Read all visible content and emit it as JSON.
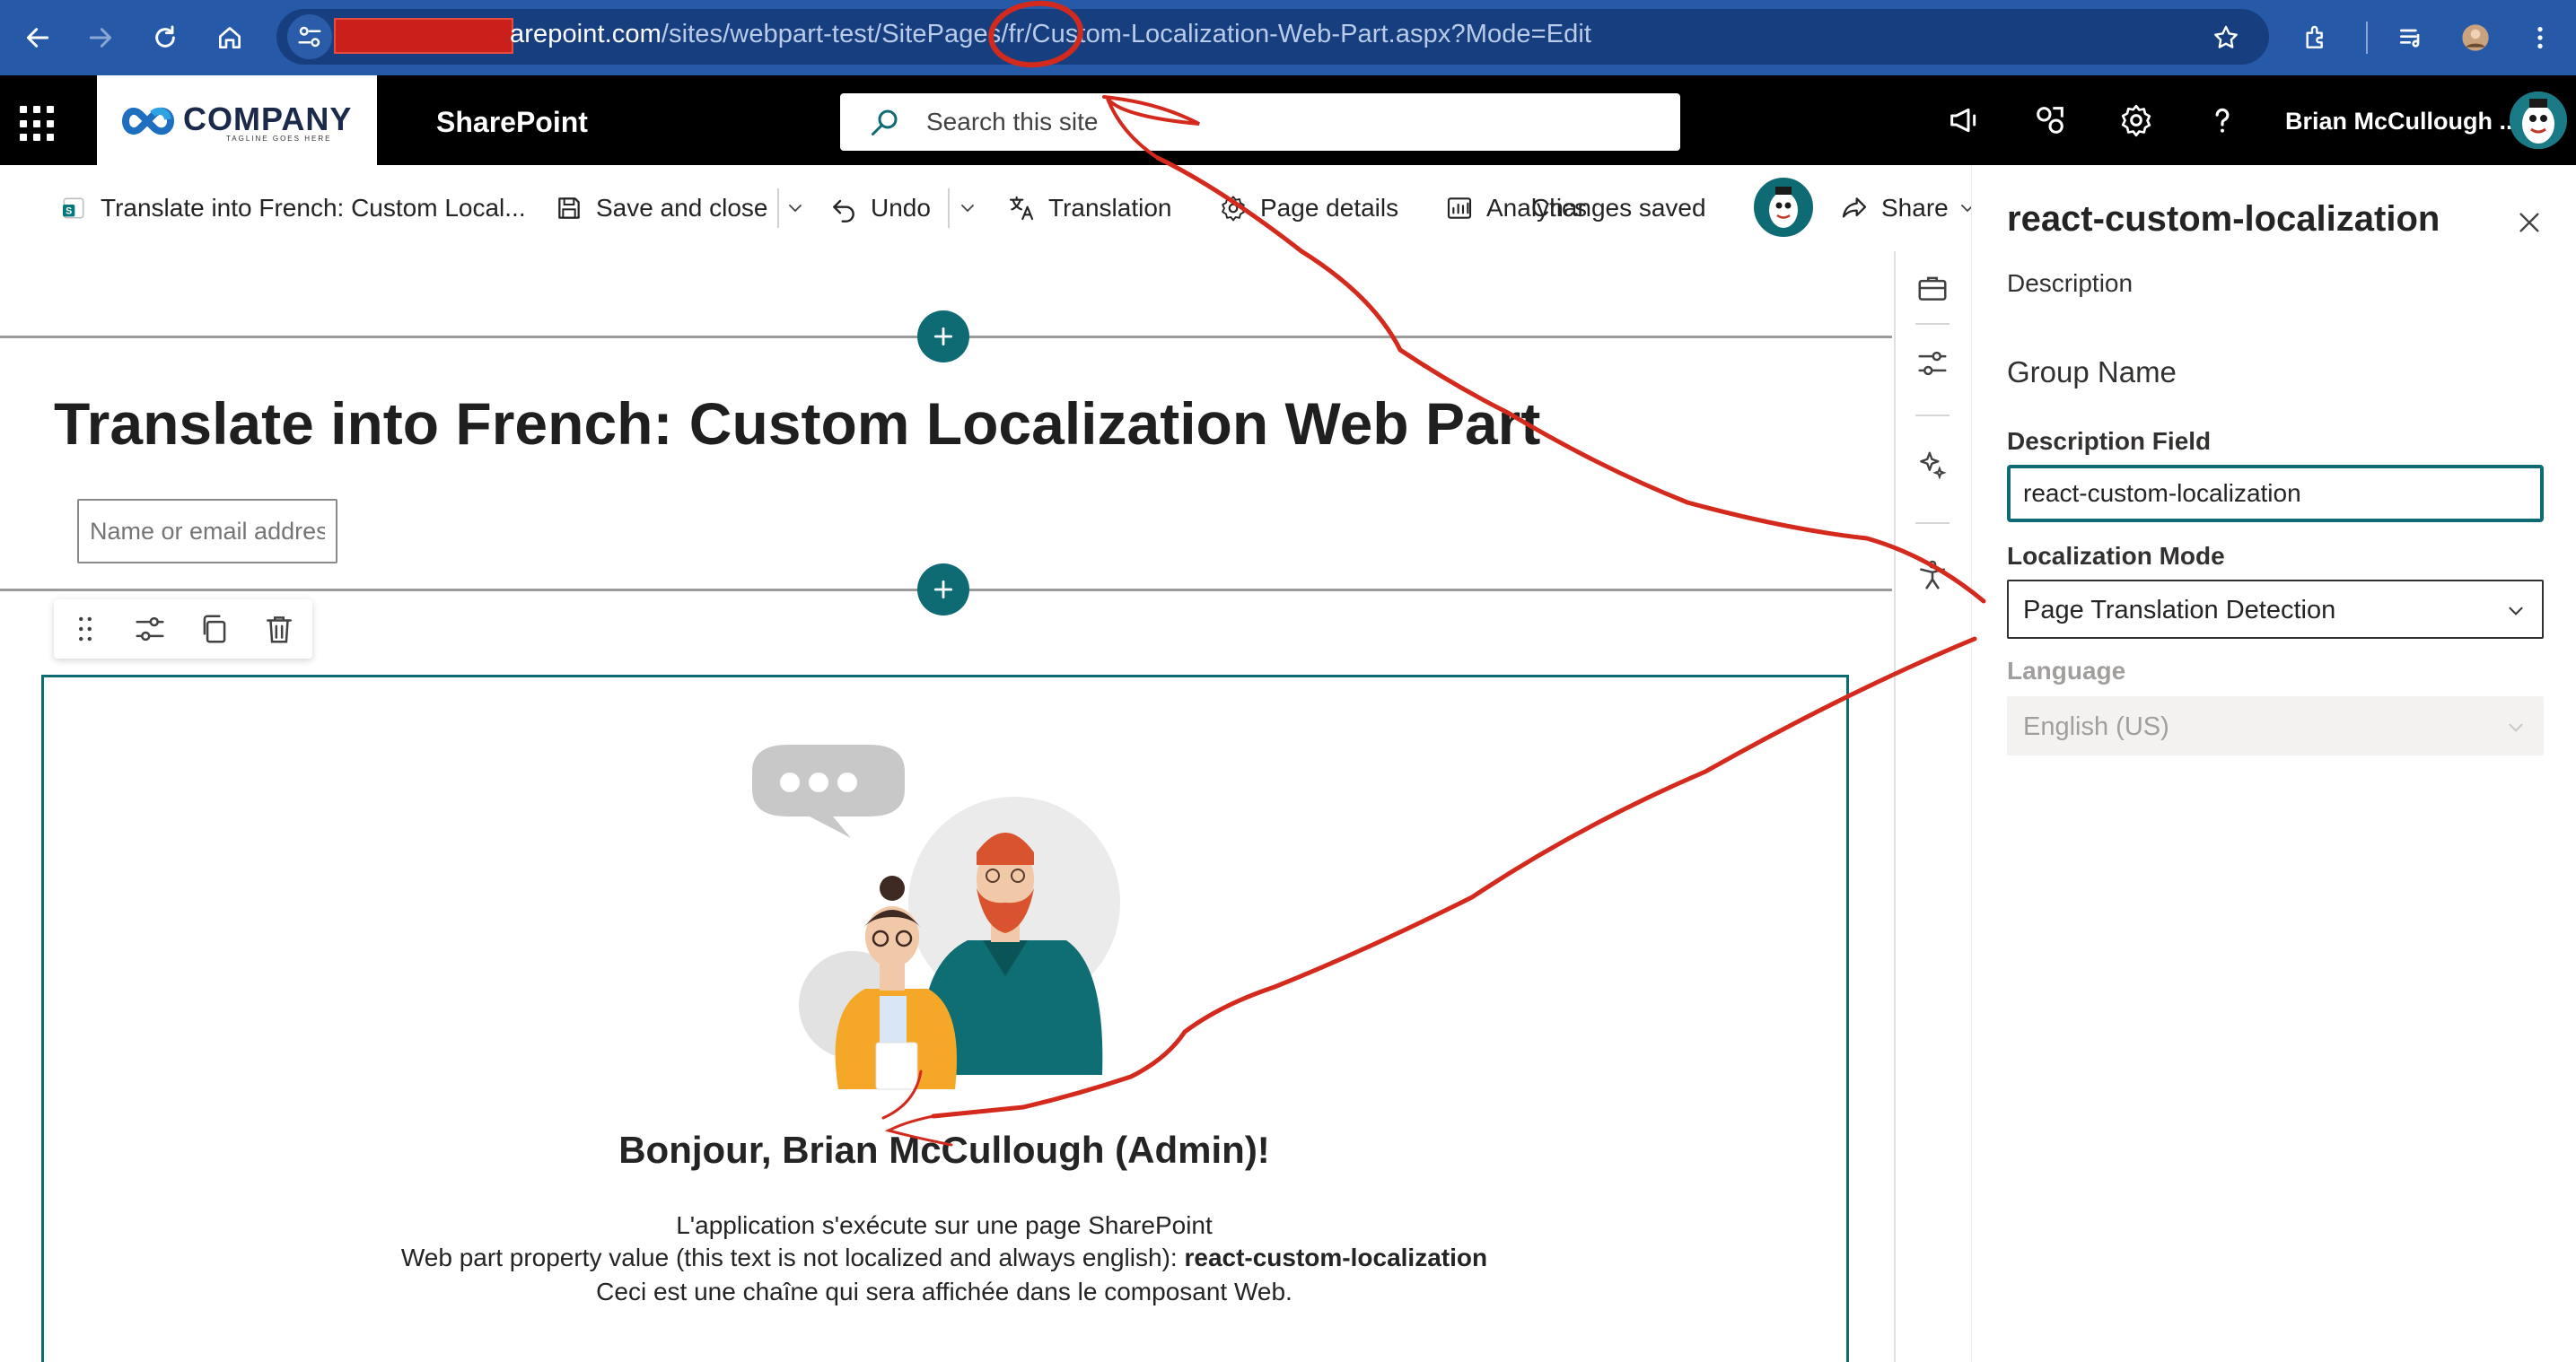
{
  "browser": {
    "url_host_tail": "arepoint.com",
    "url_path": "/sites/webpart-test/SitePages/fr/Custom-Localization-Web-Part.aspx?Mode=Edit"
  },
  "suite": {
    "logo_text": "COMPANY",
    "logo_tagline": "TAGLINE GOES HERE",
    "app_name": "SharePoint",
    "search_placeholder": "Search this site",
    "user_name": "Brian McCullough ..."
  },
  "command_bar": {
    "page_tab": "Translate into French: Custom Local...",
    "save_close": "Save and close",
    "undo": "Undo",
    "translation": "Translation",
    "page_details": "Page details",
    "analytics": "Analytics",
    "status": "Changes saved",
    "share": "Share"
  },
  "page": {
    "title": "Translate into French: Custom Localization Web Part",
    "people_placeholder": "Name or email address"
  },
  "webpart": {
    "greeting": "Bonjour, Brian McCullough (Admin)!",
    "line1": "L'application s'exécute sur une page SharePoint",
    "line2_prefix": "Web part property value (this text is not localized and always english): ",
    "line2_value": "react-custom-localization",
    "line3": "Ceci est une chaîne qui sera affichée dans le composant Web."
  },
  "property_pane": {
    "title": "react-custom-localization",
    "description": "Description",
    "group_name": "Group Name",
    "description_field_label": "Description Field",
    "description_field_value": "react-custom-localization",
    "localization_mode_label": "Localization Mode",
    "localization_mode_value": "Page Translation Detection",
    "language_label": "Language",
    "language_value": "English (US)"
  },
  "colors": {
    "browser_bar": "#2659a8",
    "suite_bar": "#000000",
    "theme_teal": "#0f6b73",
    "annotation_red": "#d42a1e"
  },
  "icons": [
    "back-icon",
    "forward-icon",
    "reload-icon",
    "home-icon",
    "site-info-icon",
    "star-icon",
    "extensions-icon",
    "media-icon",
    "profile-icon",
    "more-icon",
    "waffle-icon",
    "search-icon",
    "megaphone-icon",
    "connections-icon",
    "gear-icon",
    "help-icon",
    "sharepoint-page-icon",
    "save-icon",
    "undo-icon",
    "translation-icon",
    "page-details-icon",
    "analytics-icon",
    "share-icon",
    "plus-icon",
    "drag-icon",
    "edit-properties-icon",
    "duplicate-icon",
    "delete-icon",
    "toolbox-icon",
    "sliders-icon",
    "design-ideas-icon",
    "accessibility-icon",
    "close-icon",
    "chevron-down-icon"
  ]
}
